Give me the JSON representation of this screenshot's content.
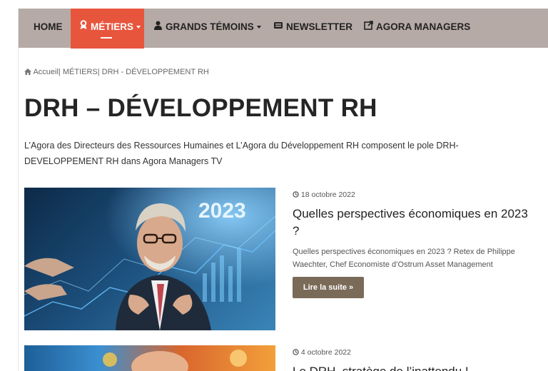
{
  "nav": {
    "items": [
      {
        "label": "HOME",
        "icon": ""
      },
      {
        "label": "MÉTIERS",
        "icon": "user-badge-icon"
      },
      {
        "label": "GRANDS TÉMOINS",
        "icon": "users-icon"
      },
      {
        "label": "NEWSLETTER",
        "icon": "newspaper-icon"
      },
      {
        "label": "AGORA MANAGERS",
        "icon": "external-link-icon"
      }
    ],
    "active_color": "#e8553d",
    "bar_color": "#b6aaa6"
  },
  "breadcrumb": {
    "home": "Accueil",
    "separator": "|",
    "level1": "MÉTIERS",
    "level2": "DRH - DÉVELOPPEMENT RH"
  },
  "page": {
    "title": "DRH – DÉVELOPPEMENT RH",
    "intro": "L’Agora des Directeurs des Ressources Humaines et L’Agora du Développement RH composent le pole DRH-DEVELOPPEMENT RH dans Agora Managers TV"
  },
  "articles": [
    {
      "date": "18 octobre 2022",
      "title": "Quelles perspectives économiques en 2023 ?",
      "excerpt": "Quelles perspectives économiques en 2023 ? Retex de Philippe Waechter, Chef Economiste d’Ostrum Asset Management",
      "read_more": "Lire la suite »",
      "image_text": "2023"
    },
    {
      "date": "4 octobre 2022",
      "title": "Le DRH, stratège de l’inattendu !"
    }
  ]
}
